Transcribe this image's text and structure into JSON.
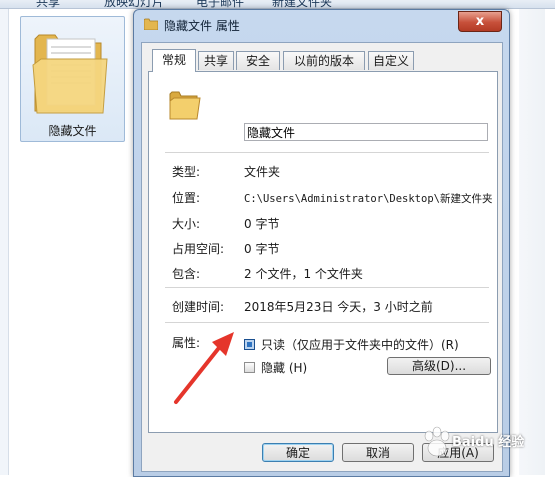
{
  "explorer": {
    "toolbar_items": [
      "共享",
      "放映幻灯片",
      "电子邮件",
      "新建文件夹"
    ],
    "selected_folder_name": "隐藏文件"
  },
  "dialog": {
    "title": "隐藏文件 属性",
    "close_glyph": "x",
    "tabs": [
      {
        "label": "常规",
        "active": true
      },
      {
        "label": "共享",
        "active": false
      },
      {
        "label": "安全",
        "active": false
      },
      {
        "label": "以前的版本",
        "active": false
      },
      {
        "label": "自定义",
        "active": false
      }
    ],
    "general": {
      "name_value": "隐藏文件",
      "rows": [
        {
          "label": "类型:",
          "value": "文件夹"
        },
        {
          "label": "位置:",
          "value": "C:\\Users\\Administrator\\Desktop\\新建文件夹"
        },
        {
          "label": "大小:",
          "value": "0 字节"
        },
        {
          "label": "占用空间:",
          "value": "0 字节"
        },
        {
          "label": "包含:",
          "value": "2 个文件，1 个文件夹"
        },
        {
          "label": "创建时间:",
          "value": "2018年5月23日 今天，3 小时之前"
        }
      ],
      "attributes_label": "属性:",
      "readonly": {
        "label": "只读（仅应用于文件夹中的文件）(R)",
        "checked": true
      },
      "hidden": {
        "label": "隐藏 (H)",
        "checked": false
      },
      "advanced_button": "高级(D)..."
    },
    "buttons": {
      "ok": "确定",
      "cancel": "取消",
      "apply": "应用(A)"
    }
  },
  "watermark": {
    "text": "Baidu 经验"
  },
  "colors": {
    "arrow": "#e5352b",
    "accent": "#2f74c2"
  }
}
